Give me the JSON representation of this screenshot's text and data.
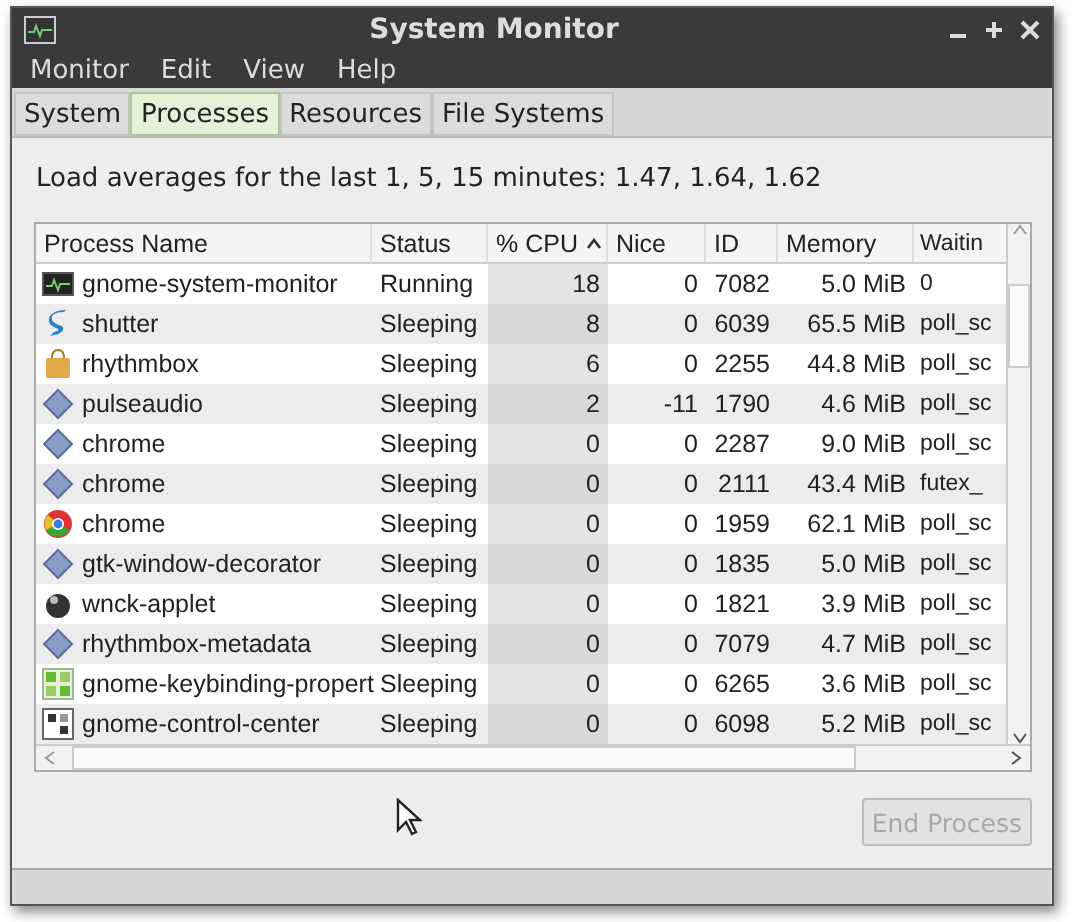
{
  "window": {
    "title": "System Monitor"
  },
  "menu": [
    "Monitor",
    "Edit",
    "View",
    "Help"
  ],
  "tabs": [
    {
      "label": "System",
      "selected": false
    },
    {
      "label": "Processes",
      "selected": true
    },
    {
      "label": "Resources",
      "selected": false
    },
    {
      "label": "File Systems",
      "selected": false
    }
  ],
  "load_averages": "Load averages for the last 1, 5, 15 minutes: 1.47, 1.64, 1.62",
  "table": {
    "columns": [
      {
        "label": "Process Name",
        "sorted": false
      },
      {
        "label": "Status",
        "sorted": false
      },
      {
        "label": "% CPU",
        "sorted": true
      },
      {
        "label": "Nice",
        "sorted": false
      },
      {
        "label": "ID",
        "sorted": false
      },
      {
        "label": "Memory",
        "sorted": false
      },
      {
        "label": "Waitin",
        "sorted": false
      }
    ],
    "rows": [
      {
        "kind": "monitor",
        "cells": [
          "gnome-system-monitor",
          "Running",
          "18",
          "0",
          "7082",
          "5.0 MiB",
          "0"
        ]
      },
      {
        "kind": "shutter",
        "cells": [
          "shutter",
          "Sleeping",
          "8",
          "0",
          "6039",
          "65.5 MiB",
          "poll_sc"
        ]
      },
      {
        "kind": "bag",
        "cells": [
          "rhythmbox",
          "Sleeping",
          "6",
          "0",
          "2255",
          "44.8 MiB",
          "poll_sc"
        ]
      },
      {
        "kind": "diamond",
        "cells": [
          "pulseaudio",
          "Sleeping",
          "2",
          "-11",
          "1790",
          "4.6 MiB",
          "poll_sc"
        ]
      },
      {
        "kind": "diamond",
        "cells": [
          "chrome",
          "Sleeping",
          "0",
          "0",
          "2287",
          "9.0 MiB",
          "poll_sc"
        ]
      },
      {
        "kind": "diamond",
        "cells": [
          "chrome",
          "Sleeping",
          "0",
          "0",
          "2111",
          "43.4 MiB",
          "futex_"
        ]
      },
      {
        "kind": "chrome",
        "cells": [
          "chrome",
          "Sleeping",
          "0",
          "0",
          "1959",
          "62.1 MiB",
          "poll_sc"
        ]
      },
      {
        "kind": "diamond",
        "cells": [
          "gtk-window-decorator",
          "Sleeping",
          "0",
          "0",
          "1835",
          "5.0 MiB",
          "poll_sc"
        ]
      },
      {
        "kind": "ball",
        "cells": [
          "wnck-applet",
          "Sleeping",
          "0",
          "0",
          "1821",
          "3.9 MiB",
          "poll_sc"
        ]
      },
      {
        "kind": "diamond",
        "cells": [
          "rhythmbox-metadata",
          "Sleeping",
          "0",
          "0",
          "7079",
          "4.7 MiB",
          "poll_sc"
        ]
      },
      {
        "kind": "keys",
        "cells": [
          "gnome-keybinding-propert",
          "Sleeping",
          "0",
          "0",
          "6265",
          "3.6 MiB",
          "poll_sc"
        ]
      },
      {
        "kind": "control",
        "cells": [
          "gnome-control-center",
          "Sleeping",
          "0",
          "0",
          "6098",
          "5.2 MiB",
          "poll_sc"
        ]
      }
    ]
  },
  "end_process": {
    "label": "End Process",
    "disabled": true
  }
}
